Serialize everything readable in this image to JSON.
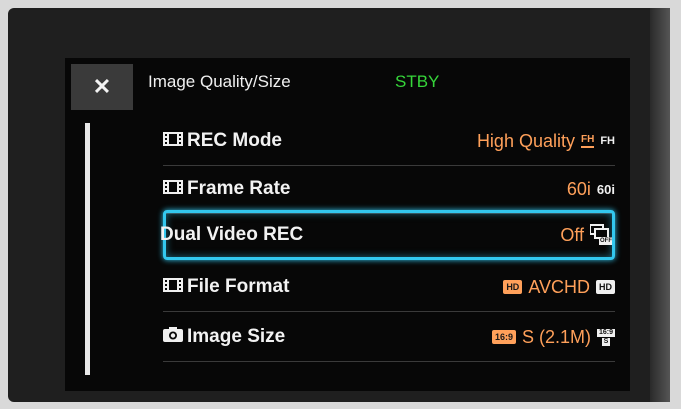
{
  "header": {
    "close_label": "✕",
    "title": "Image Quality/Size",
    "status": "STBY"
  },
  "menu": {
    "rows": [
      {
        "label": "REC Mode",
        "value": "High Quality",
        "badge_orange": "FH",
        "badge_white": "FH"
      },
      {
        "label": "Frame Rate",
        "value": "60i",
        "badge_white": "60i"
      },
      {
        "label": "Dual Video REC",
        "value": "Off",
        "badge_white": "OFF"
      },
      {
        "label": "File Format",
        "value": "AVCHD",
        "badge_orange": "HD",
        "badge_white": "HD"
      },
      {
        "label": "Image Size",
        "value": "S (2.1M)",
        "badge_orange": "16:9",
        "badge_white_top": "16:9",
        "badge_white_bottom": "S"
      }
    ]
  },
  "icons": {
    "close": "close-icon",
    "film": "film-icon",
    "camera": "camera-icon",
    "dual_rec": "dual-rec-icon"
  },
  "colors": {
    "status": "#36d63a",
    "value": "#ffa05a",
    "selection": "#33c8ef"
  }
}
